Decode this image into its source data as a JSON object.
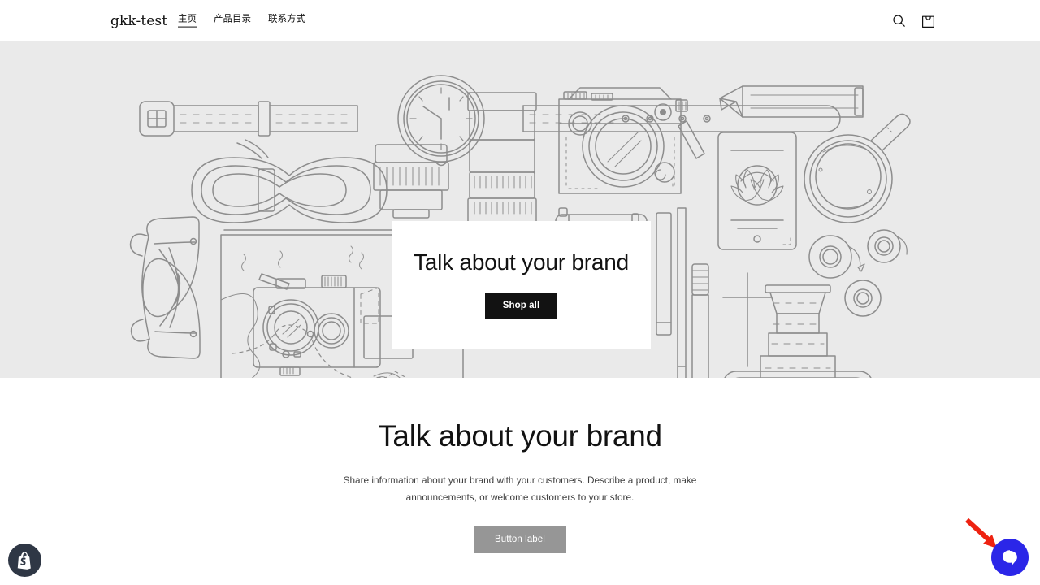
{
  "header": {
    "logo": "gkk-test",
    "nav": [
      {
        "label": "主页",
        "active": true
      },
      {
        "label": "产品目录",
        "active": false
      },
      {
        "label": "联系方式",
        "active": false
      }
    ],
    "actions": [
      {
        "name": "search-icon",
        "label": "搜索"
      },
      {
        "name": "cart-icon",
        "label": "购物车"
      }
    ]
  },
  "hero": {
    "background_color": "#eaeaea",
    "illustration": "flat-lay line art of watch, rope, camera lens, glasses, map, vintage camera, SLR camera, pencil, notebook, pen, tablet, coffee cup, tape rolls, tripod lens stack",
    "card": {
      "title": "Talk about your brand",
      "button_label": "Shop all",
      "button_color": "#121212",
      "background_color": "#ffffff"
    }
  },
  "rich_text": {
    "title": "Talk about your brand",
    "body": "Share information about your brand with your customers. Describe a product, make announcements, or welcome customers to your store.",
    "button_label": "Button label",
    "button_color": "#969696"
  },
  "shopify_badge": {
    "name": "shopify-logo",
    "background_color": "#2f3745"
  },
  "chat_widget": {
    "name": "chat-launcher",
    "background_color": "#2b26e8",
    "icon": "speech-bubble-icon"
  },
  "annotation": {
    "name": "red-arrow",
    "color": "#ee2211",
    "points_to": "chat-launcher"
  }
}
